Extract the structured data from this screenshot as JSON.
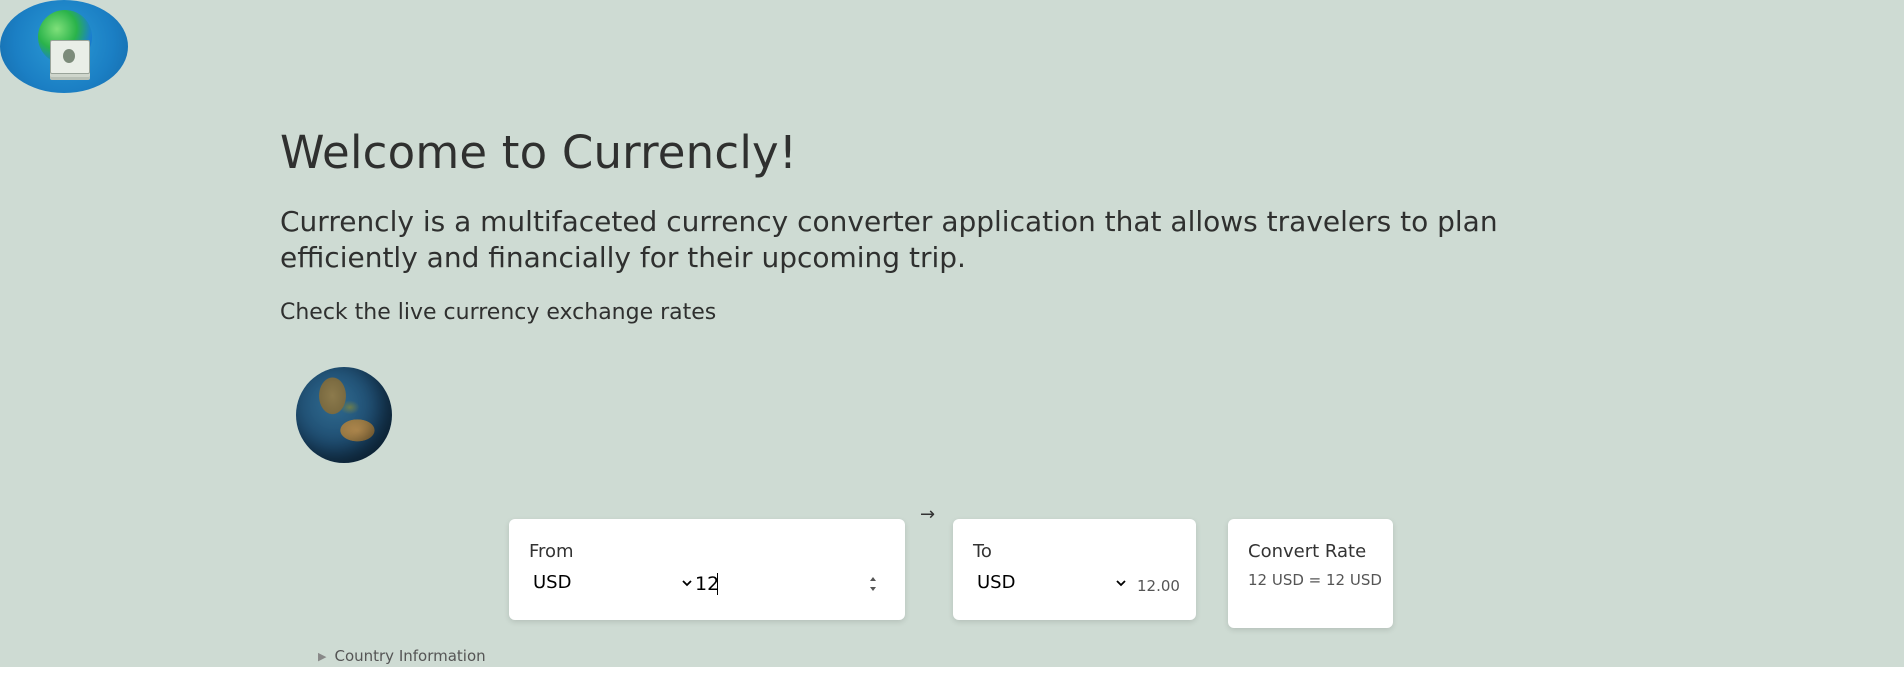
{
  "header": {
    "logo_icon": "money-globe-logo"
  },
  "main": {
    "title": "Welcome to Currencly!",
    "subtitle": "Currencly is a multifaceted currency converter application that allows travelers to plan efficiently and financially for their upcoming trip.",
    "rates_heading": "Check the live currency exchange rates",
    "globe_icon": "earth-globe-image"
  },
  "converter": {
    "from": {
      "label": "From",
      "currency": "USD",
      "amount": "12"
    },
    "arrow": "→",
    "to": {
      "label": "To",
      "currency": "USD",
      "value": "12.00"
    },
    "rate": {
      "label": "Convert Rate",
      "text": "12 USD = 12 USD"
    }
  },
  "country_info": {
    "label": "Country Information"
  },
  "colors": {
    "background": "#cedbd3",
    "card": "#ffffff",
    "text": "#2f302f"
  }
}
